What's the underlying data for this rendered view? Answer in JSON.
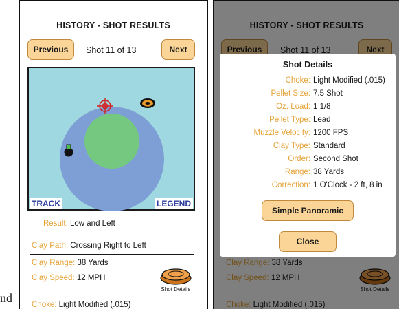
{
  "stray_text": "nd",
  "left_screen": {
    "title": "HISTORY - SHOT RESULTS",
    "prev_label": "Previous",
    "shot_counter": "Shot 11 of 13",
    "next_label": "Next",
    "track_label": "TRACK",
    "legend_label": "LEGEND",
    "result_label": "Result:",
    "result_value": "Low and Left",
    "clay_path_label": "Clay Path:",
    "clay_path_value": "Crossing Right to Left",
    "clay_range_label": "Clay Range:",
    "clay_range_value": "38 Yards",
    "clay_speed_label": "Clay Speed:",
    "clay_speed_value": "12 MPH",
    "shot_details_label": "Shot Details",
    "choke_label": "Choke:",
    "choke_value": "Light Modified (.015)"
  },
  "right_screen": {
    "title": "HISTORY - SHOT RESULTS",
    "prev_label": "Previous",
    "shot_counter": "Shot 11 of 13",
    "next_label": "Next",
    "clay_range_label": "Clay Range:",
    "clay_range_value": "38 Yards",
    "clay_speed_label": "Clay Speed:",
    "clay_speed_value": "12 MPH",
    "shot_details_label": "Shot Details",
    "choke_label": "Choke:",
    "choke_value": "Light Modified (.015)",
    "modal": {
      "title": "Shot Details",
      "rows": [
        {
          "label": "Choke:",
          "value": "Light Modified (.015)"
        },
        {
          "label": "Pellet Size:",
          "value": "7.5 Shot"
        },
        {
          "label": "Oz. Load:",
          "value": "1 1/8"
        },
        {
          "label": "Pellet Type:",
          "value": "Lead"
        },
        {
          "label": "Muzzle Velocity:",
          "value": "1200 FPS"
        },
        {
          "label": "Clay Type:",
          "value": "Standard"
        },
        {
          "label": "Order:",
          "value": "Second Shot"
        },
        {
          "label": "Range:",
          "value": "38 Yards"
        },
        {
          "label": "Correction:",
          "value": "1 O'Clock - 2 ft, 8 in"
        }
      ],
      "panoramic_label": "Simple Panoramic",
      "close_label": "Close"
    }
  },
  "colors": {
    "accent_orange": "#e5a338",
    "button_fill": "#fbd597",
    "target_background": "#9fd8e0",
    "outer_ring": "#7d9fd6",
    "inner_ring": "#74c880",
    "label_blue": "#2c3d9c",
    "crosshair_red": "#d42020"
  },
  "icons": [
    "crosshair-icon",
    "clay-target-icon",
    "shot-pellet-icon",
    "clay-pigeon-icon"
  ]
}
